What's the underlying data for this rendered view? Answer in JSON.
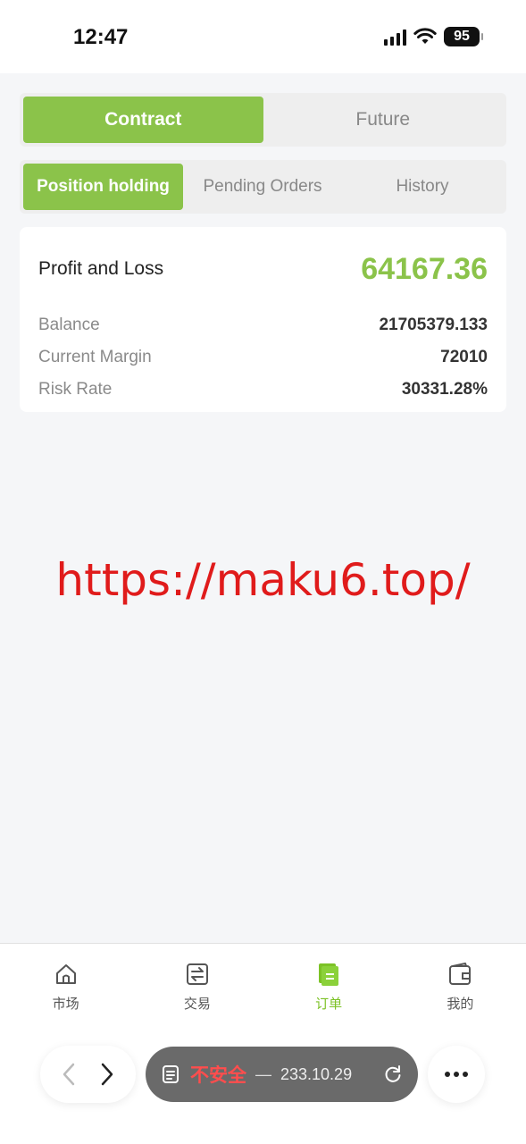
{
  "status_bar": {
    "time": "12:47",
    "battery": "95"
  },
  "main_tabs": [
    {
      "label": "Contract",
      "active": true
    },
    {
      "label": "Future",
      "active": false
    }
  ],
  "sub_tabs": [
    {
      "label": "Position holding",
      "active": true
    },
    {
      "label": "Pending Orders",
      "active": false
    },
    {
      "label": "History",
      "active": false
    }
  ],
  "pnl": {
    "label": "Profit and Loss",
    "value": "64167.36",
    "rows": [
      {
        "label": "Balance",
        "value": "21705379.133"
      },
      {
        "label": "Current Margin",
        "value": "72010"
      },
      {
        "label": "Risk Rate",
        "value": "30331.28%"
      }
    ]
  },
  "watermark": "https://maku6.top/",
  "bottom_nav": [
    {
      "label": "市场",
      "icon": "home-icon",
      "active": false
    },
    {
      "label": "交易",
      "icon": "exchange-icon",
      "active": false
    },
    {
      "label": "订单",
      "icon": "order-icon",
      "active": true
    },
    {
      "label": "我的",
      "icon": "wallet-icon",
      "active": false
    }
  ],
  "browser": {
    "insecure_label": "不安全",
    "separator": "—",
    "url": "233.10.29"
  },
  "colors": {
    "accent": "#8bc34a",
    "nav_active": "#7cc226",
    "watermark": "#e01b1b"
  }
}
